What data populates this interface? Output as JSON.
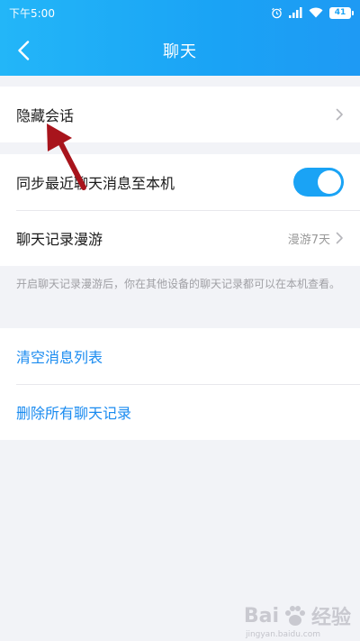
{
  "status_bar": {
    "time": "下午5:00",
    "battery": "41",
    "icons": [
      "alarm-icon",
      "signal-icon",
      "wifi-icon",
      "battery-icon"
    ]
  },
  "nav": {
    "title": "聊天",
    "back_icon": "chevron-left-icon"
  },
  "group1": {
    "items": [
      {
        "label": "隐藏会话"
      }
    ]
  },
  "group2": {
    "items": [
      {
        "label": "同步最近聊天消息至本机",
        "toggle_on": true
      },
      {
        "label": "聊天记录漫游",
        "value": "漫游7天"
      }
    ]
  },
  "hint": "开启聊天记录漫游后，你在其他设备的聊天记录都可以在本机查看。",
  "group3": {
    "items": [
      {
        "label": "清空消息列表"
      },
      {
        "label": "删除所有聊天记录"
      }
    ]
  },
  "watermark": {
    "text": "Bai",
    "text2": "经验",
    "sub": "jingyan.baidu.com"
  },
  "colors": {
    "header": "#1aa3f5",
    "link": "#1a8bf0",
    "annotation_arrow": "#a8141c",
    "background": "#f2f3f7"
  }
}
